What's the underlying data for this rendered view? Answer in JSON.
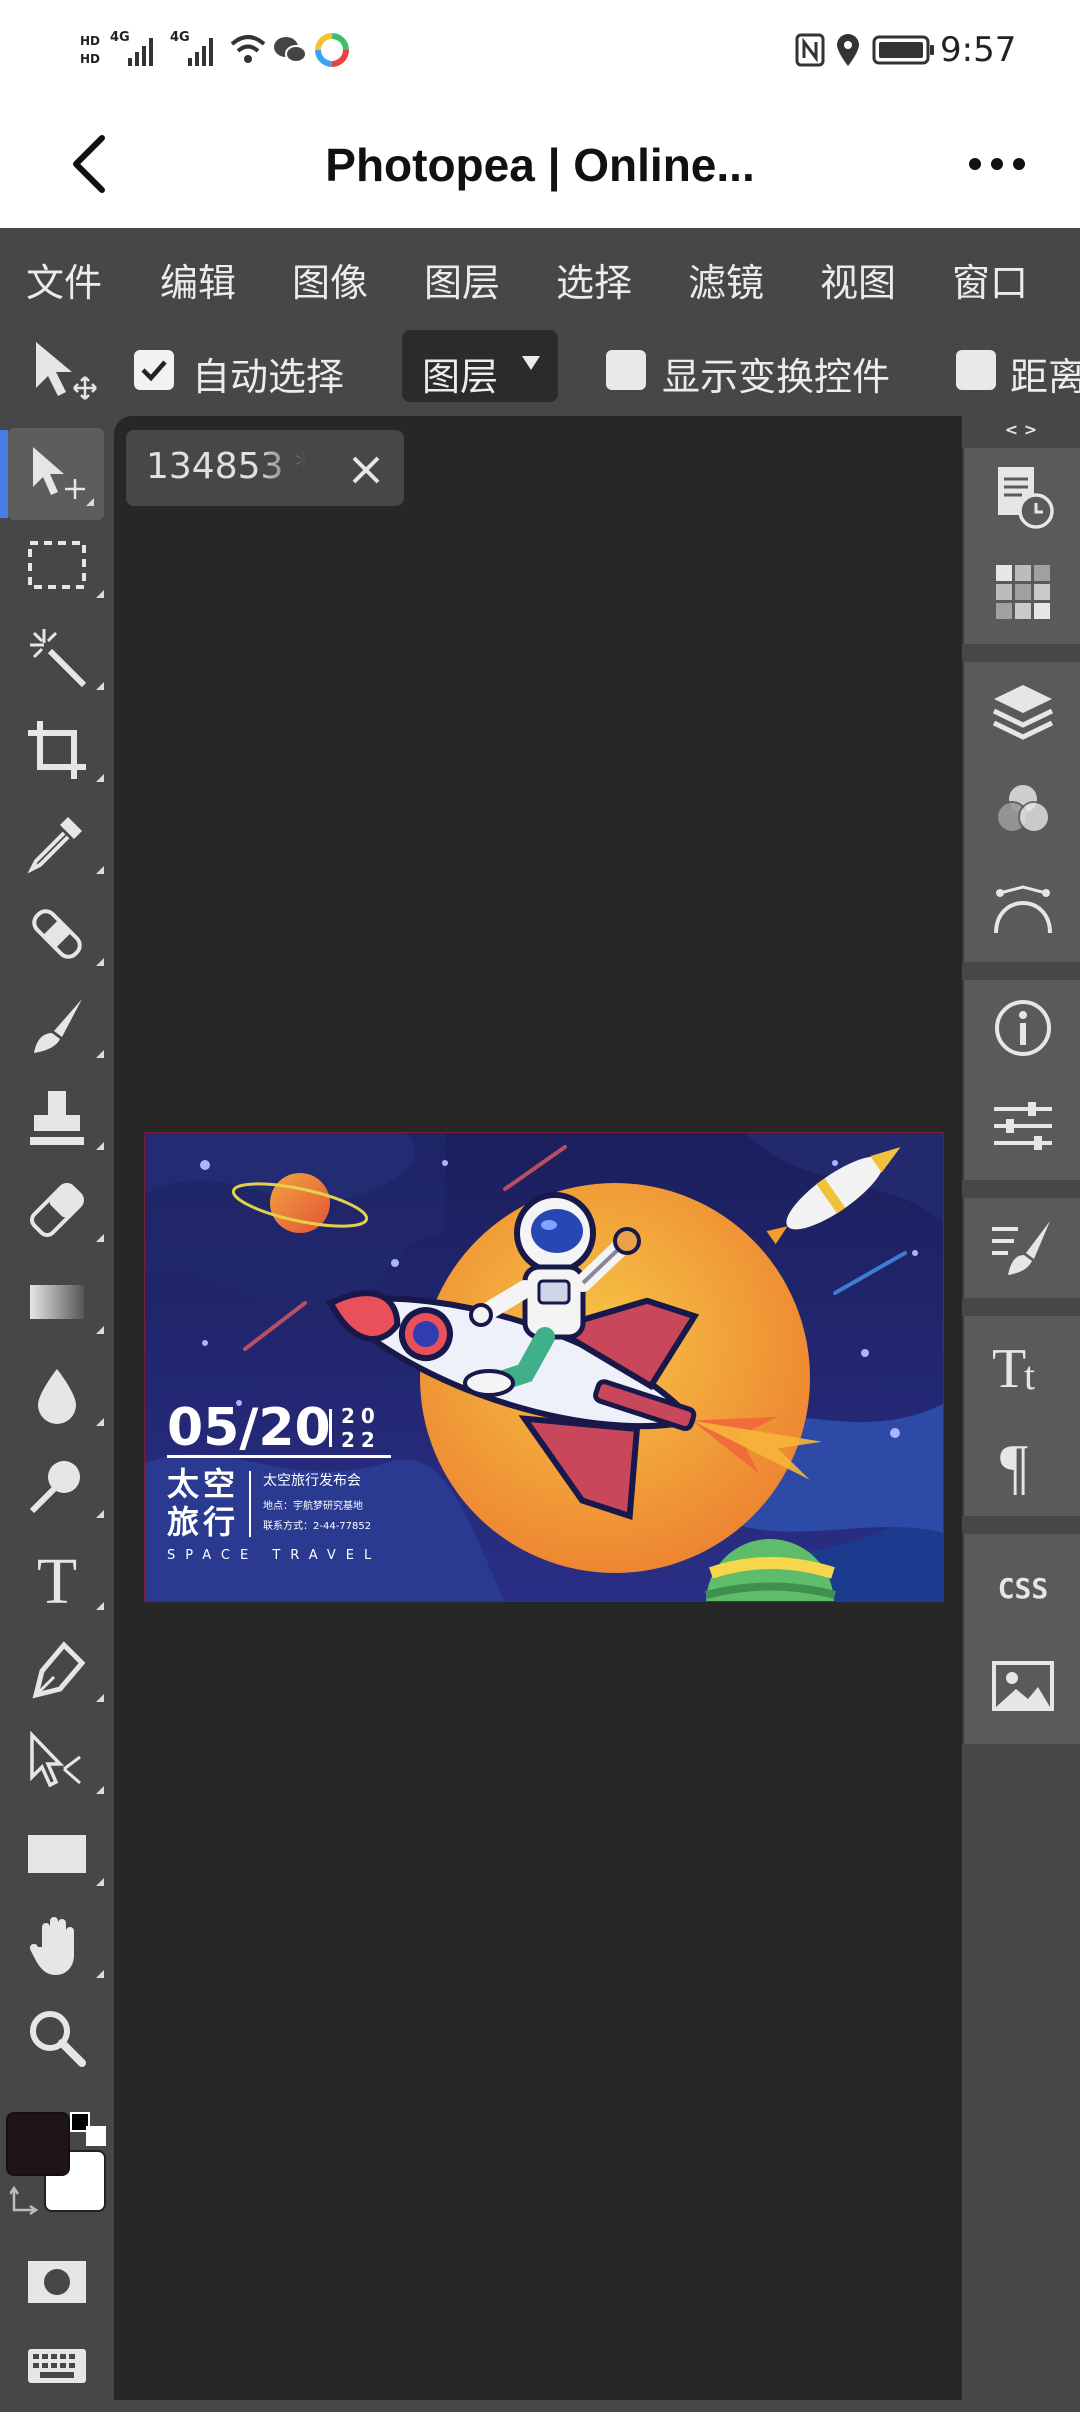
{
  "status_bar": {
    "network1": "4G",
    "network2": "4G",
    "hd1": "HD",
    "hd2": "HD",
    "time": "9:57"
  },
  "title_bar": {
    "title": "Photopea | Online..."
  },
  "menu": {
    "items": [
      "文件",
      "编辑",
      "图像",
      "图层",
      "选择",
      "滤镜",
      "视图",
      "窗口"
    ]
  },
  "options": {
    "auto_select_label": "自动选择",
    "auto_select_checked": true,
    "layer_dropdown": "图层",
    "show_transform_label": "显示变换控件",
    "distance_label": "距离"
  },
  "document": {
    "tab_name": "134853 *",
    "poster": {
      "date": "05/20",
      "year_top": "20",
      "year_bottom": "22",
      "title_line1": "太空",
      "title_line2": "旅行",
      "event": "太空旅行发布会",
      "address": "地点：宇航梦研究基地",
      "contact": "联系方式：2-44-77852",
      "subtitle": "SPACE TRAVEL"
    }
  },
  "right_panel": {
    "toggle": "< >",
    "css_label": "CSS"
  },
  "colors": {
    "app_bg": "#474747",
    "canvas_bg": "#272727",
    "foreground_swatch": "#1e1418",
    "background_swatch": "#ffffff",
    "accent": "#4a7ce8"
  }
}
